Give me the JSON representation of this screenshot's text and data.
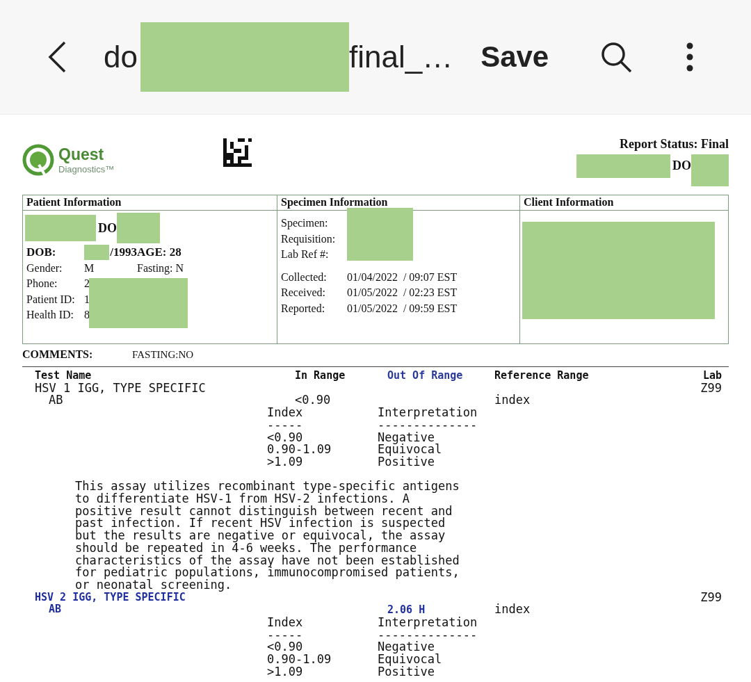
{
  "app_bar": {
    "title_start": "do",
    "title_end": "final_…",
    "save": "Save"
  },
  "report": {
    "logo": {
      "name": "Quest",
      "tagline": "Diagnostics™"
    },
    "status": "Report Status: Final",
    "name_visible": "DO",
    "patient": {
      "heading": "Patient Information",
      "name_visible": "DO",
      "dob_label": "DOB:",
      "dob_visible": "/1993",
      "age": "AGE: 28",
      "rows": [
        {
          "label": "Gender:",
          "value": "M",
          "extra": "Fasting: N"
        },
        {
          "label": "Phone:",
          "value": "2"
        },
        {
          "label": "Patient ID:",
          "value": "1"
        },
        {
          "label": "Health ID:",
          "value": "8"
        }
      ]
    },
    "specimen": {
      "heading": "Specimen Information",
      "ids": [
        "Specimen:",
        "Requisition:",
        "Lab Ref #:"
      ],
      "dates": [
        {
          "label": "Collected:",
          "value": "01/04/2022  / 09:07 EST"
        },
        {
          "label": "Received:",
          "value": "01/05/2022  / 02:23 EST"
        },
        {
          "label": "Reported:",
          "value": "01/05/2022  / 09:59 EST"
        }
      ]
    },
    "client": {
      "heading": "Client Information"
    },
    "comments": {
      "label": "COMMENTS:",
      "value": "FASTING:NO"
    }
  },
  "results": {
    "columns": {
      "test_name": "Test Name",
      "in_range": "In Range",
      "out_of_range": "Out Of Range",
      "reference_range": "Reference Range",
      "lab": "Lab"
    },
    "tests": [
      {
        "name": "HSV 1 IGG, TYPE SPECIFIC",
        "sub": "AB",
        "flagged": false,
        "in_range": "<0.90",
        "reference": "index",
        "lab": "Z99",
        "interp_headers": [
          "Index",
          "Interpretation"
        ],
        "interp_rules": [
          "-----",
          "--------------"
        ],
        "interp_rows": [
          [
            "<0.90",
            "Negative"
          ],
          [
            "0.90-1.09",
            "Equivocal"
          ],
          [
            ">1.09",
            "Positive"
          ]
        ],
        "note": "This assay utilizes recombinant type-specific antigens\nto differentiate HSV-1 from HSV-2 infections. A\npositive result cannot distinguish between recent and\npast infection. If recent HSV infection is suspected\nbut the results are negative or equivocal, the assay\nshould be repeated in 4-6 weeks. The performance\ncharacteristics of the assay have not been established\nfor pediatric populations, immunocompromised patients,\nor neonatal screening."
      },
      {
        "name": "HSV 2 IGG, TYPE SPECIFIC",
        "sub": "AB",
        "flagged": true,
        "out_of_range": "2.06 H",
        "reference": "index",
        "lab": "Z99",
        "interp_headers": [
          "Index",
          "Interpretation"
        ],
        "interp_rules": [
          "-----",
          "--------------"
        ],
        "interp_rows": [
          [
            "<0.90",
            "Negative"
          ],
          [
            "0.90-1.09",
            "Equivocal"
          ],
          [
            ">1.09",
            "Positive"
          ]
        ]
      }
    ]
  }
}
